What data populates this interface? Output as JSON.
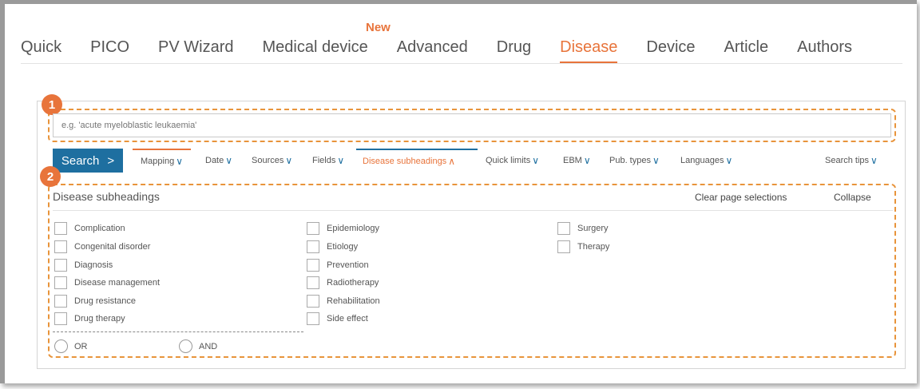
{
  "tabs": [
    {
      "label": "Quick"
    },
    {
      "label": "PICO"
    },
    {
      "label": "PV Wizard"
    },
    {
      "label": "Medical device"
    },
    {
      "label": "Advanced"
    },
    {
      "label": "Drug"
    },
    {
      "label": "Disease",
      "active": true
    },
    {
      "label": "Device"
    },
    {
      "label": "Article"
    },
    {
      "label": "Authors"
    }
  ],
  "new_badge": "New",
  "markers": [
    "1",
    "2"
  ],
  "search": {
    "placeholder": "e.g. 'acute myeloblastic leukaemia'",
    "button_label": "Search",
    "button_icon": ">"
  },
  "filters": {
    "mapping": "Mapping",
    "date": "Date",
    "sources": "Sources",
    "fields": "Fields",
    "disease_subheadings": "Disease subheadings",
    "quick_limits": "Quick limits",
    "ebm": "EBM",
    "pub_types": "Pub. types",
    "languages": "Languages",
    "search_tips": "Search tips",
    "chevron_down": "∨",
    "chevron_up": "∧"
  },
  "subheadings": {
    "title": "Disease subheadings",
    "clear_label": "Clear page selections",
    "collapse_label": "Collapse",
    "col1": [
      "Complication",
      "Congenital disorder",
      "Diagnosis",
      "Disease management",
      "Drug resistance",
      "Drug therapy"
    ],
    "col2": [
      "Epidemiology",
      "Etiology",
      "Prevention",
      "Radiotherapy",
      "Rehabilitation",
      "Side effect"
    ],
    "col3": [
      "Surgery",
      "Therapy"
    ],
    "or_label": "OR",
    "and_label": "AND"
  },
  "colors": {
    "accent": "#e8743b",
    "primary": "#1e6fa0"
  }
}
